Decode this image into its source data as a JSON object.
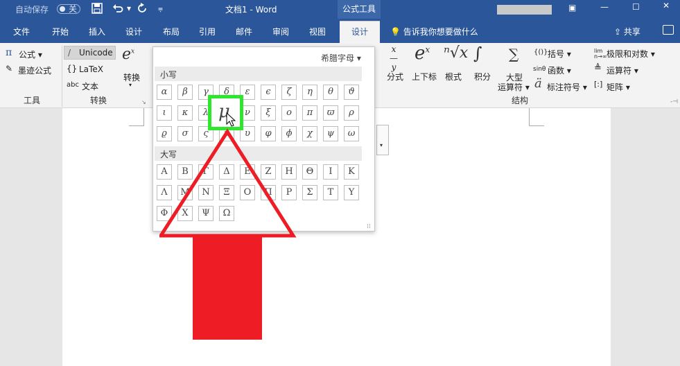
{
  "titlebar": {
    "autosave": "自动保存",
    "toggle": "关",
    "doc_title": "文档1  -  Word",
    "context_tab": "公式工具"
  },
  "tabs": [
    "文件",
    "开始",
    "插入",
    "设计",
    "布局",
    "引用",
    "邮件",
    "审阅",
    "视图"
  ],
  "active_tab": "设计",
  "tell_me": "告诉我你想要做什么",
  "share": "共享",
  "ribbon": {
    "tools": {
      "equation": "公式",
      "ink": "墨迹公式",
      "group": "工具"
    },
    "convert": {
      "unicode": "Unicode",
      "latex": "LaTeX",
      "text": "文本",
      "convert": "转换",
      "group": "转换"
    },
    "structures": {
      "fraction": "分式",
      "script": "上下标",
      "radical": "根式",
      "integral": "积分",
      "large_op": "大型",
      "large_op2": "运算符",
      "bracket": "括号",
      "function": "函数",
      "accent": "标注符号",
      "limit": "极限和对数",
      "operator": "运算符",
      "matrix": "矩阵",
      "group": "结构"
    }
  },
  "gallery": {
    "header": "希腊字母",
    "lowercase_label": "小写",
    "uppercase_label": "大写",
    "lowercase": [
      "α",
      "β",
      "γ",
      "δ",
      "ε",
      "ϵ",
      "ζ",
      "η",
      "θ",
      "ϑ",
      "ι",
      "κ",
      "λ",
      "μ",
      "ν",
      "ξ",
      "ο",
      "π",
      "ϖ",
      "ρ",
      "ϱ",
      "σ",
      "ς",
      "τ",
      "υ",
      "φ",
      "ϕ",
      "χ",
      "ψ",
      "ω"
    ],
    "uppercase": [
      "Α",
      "Β",
      "Γ",
      "Δ",
      "Ε",
      "Ζ",
      "Η",
      "Θ",
      "Ι",
      "Κ",
      "Λ",
      "Μ",
      "Ν",
      "Ξ",
      "Ο",
      "Π",
      "Ρ",
      "Σ",
      "Τ",
      "Υ",
      "Φ",
      "Χ",
      "Ψ",
      "Ω"
    ],
    "highlighted_symbol": "μ"
  },
  "annotation": {
    "highlight_color": "#2ee62e",
    "arrow_color": "#ee1c25"
  },
  "colors": {
    "titlebar": "#2b579a",
    "ribbon": "#f3f3f3"
  }
}
